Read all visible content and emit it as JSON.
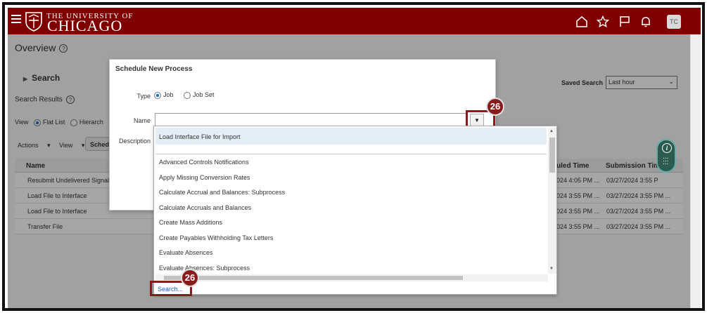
{
  "header": {
    "logo_top": "THE UNIVERSITY OF",
    "logo_main": "CHICAGO",
    "avatar": "TC",
    "icons": [
      "menu-icon",
      "home-icon",
      "star-icon",
      "flag-icon",
      "bell-icon"
    ]
  },
  "page": {
    "title": "Overview",
    "search_label": "Search",
    "search_results": "Search Results",
    "view_label": "View",
    "flat_list": "Flat List",
    "hierarchy": "Hierarch",
    "actions": "Actions",
    "view_menu": "View",
    "schedule_btn": "Schedu",
    "saved_search_label": "Saved Search",
    "saved_search_value": "Last hour"
  },
  "table": {
    "headers": {
      "name": "Name",
      "scheduled": "uled Time",
      "submission": "Submission Time"
    },
    "rows": [
      {
        "name": "Resubmit Undelivered Signals",
        "scheduled": "024 4:05 PM ...",
        "submission": "03/27/2024 3:55 P"
      },
      {
        "name": "Load File to Interface",
        "scheduled": "024 3:55 PM ...",
        "submission": "03/27/2024 3:55 PM ..."
      },
      {
        "name": "Load File to Interface",
        "scheduled": "024 3:55 PM ...",
        "submission": "03/27/2024 3:55 PM ..."
      },
      {
        "name": "Transfer File",
        "scheduled": "024 3:55 PM ...",
        "submission": "03/27/2024 3:55 PM ..."
      }
    ]
  },
  "dialog": {
    "title": "Schedule New Process",
    "type_label": "Type",
    "type_job": "Job",
    "type_jobset": "Job Set",
    "name_label": "Name",
    "name_value": "",
    "description_label": "Description"
  },
  "dropdown": {
    "selected": "Load Interface File for Import",
    "items": [
      "Advanced Controls Notifications",
      "Apply Missing Conversion Rates",
      "Calculate Accrual and Balances: Subprocess",
      "Calculate Accruals and Balances",
      "Create Mass Additions",
      "Create Payables Withholding Tax Letters",
      "Evaluate Absences",
      "Evaluate Absences: Subprocess"
    ],
    "search_link": "Search..."
  },
  "callouts": {
    "dropdown_step": "26",
    "search_step": "26"
  },
  "colors": {
    "brand": "#800000",
    "callout": "#8b1a1a",
    "link": "#1a5fa8"
  }
}
